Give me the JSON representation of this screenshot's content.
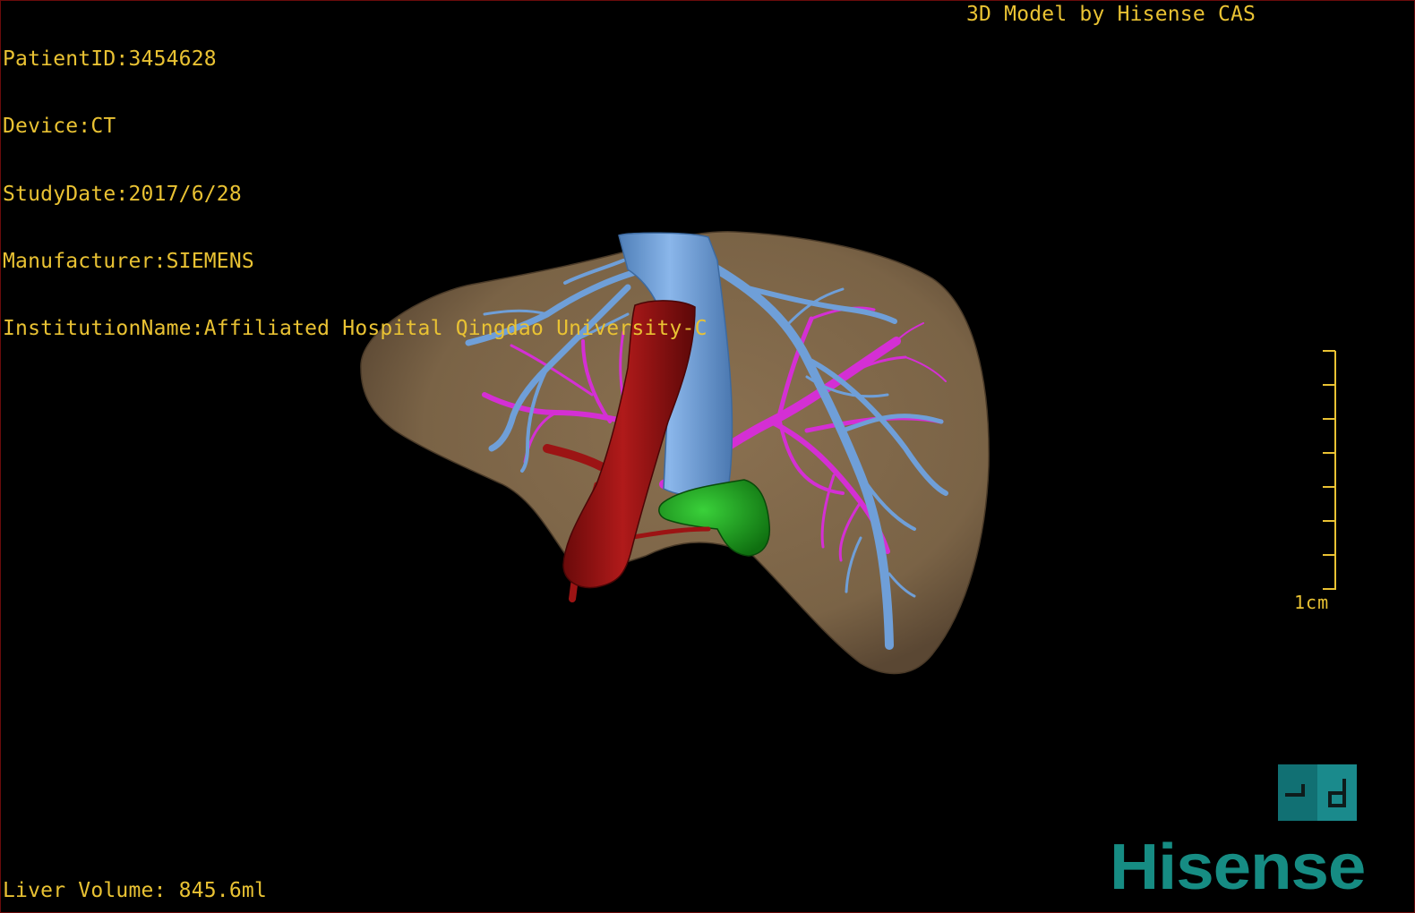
{
  "overlay": {
    "patient_id": "PatientID:3454628",
    "device": "Device:CT",
    "study_date": "StudyDate:2017/6/28",
    "manufacturer": "Manufacturer:SIEMENS",
    "institution": "InstitutionName:Affiliated Hospital Qingdao University-C",
    "credit": "3D Model by Hisense CAS",
    "liver_volume": "Liver Volume: 845.6ml"
  },
  "scale": {
    "label": "1cm"
  },
  "orientation_widget": {
    "label": "┐d",
    "color": "#16787a"
  },
  "brand": {
    "logo_text": "Hisense",
    "color": "#168c83"
  },
  "model": {
    "structures": [
      {
        "name": "liver",
        "color": "#7d6548"
      },
      {
        "name": "hepatic-veins",
        "color": "#6f9fd8"
      },
      {
        "name": "portal-vein",
        "color": "#d42fd4"
      },
      {
        "name": "inferior-vena-cava",
        "color": "#9c1414"
      },
      {
        "name": "gallbladder",
        "color": "#1ea31e"
      }
    ]
  },
  "colors": {
    "overlay_text": "#e9c233",
    "background": "#000000"
  }
}
